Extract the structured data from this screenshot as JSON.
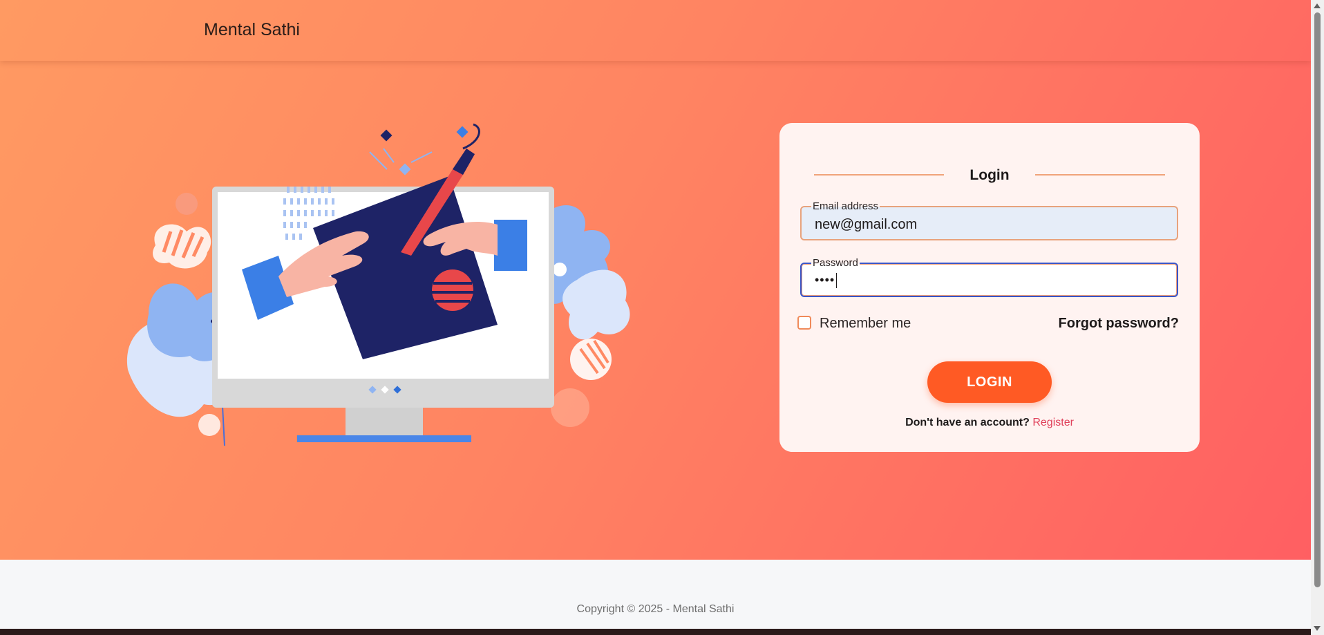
{
  "app": {
    "brand": "Mental Sathi"
  },
  "login": {
    "title": "Login",
    "email_label": "Email address",
    "email_value": "new@gmail.com",
    "password_label": "Password",
    "password_dots": "••••",
    "remember_label": "Remember me",
    "forgot_label": "Forgot password?",
    "button_label": "LOGIN",
    "signup_text": "Don't have an account?",
    "register_label": "Register"
  },
  "footer": {
    "copyright": "Copyright © 2025 - Mental Sathi"
  },
  "colors": {
    "hero_gradient_start": "#ff9a62",
    "hero_gradient_end": "#ff5f62",
    "button": "#ff5a24",
    "register_link": "#e0405a",
    "card": "#fff3f1"
  },
  "icons": {
    "hero_illustration": "computer-drawing-illustration"
  }
}
